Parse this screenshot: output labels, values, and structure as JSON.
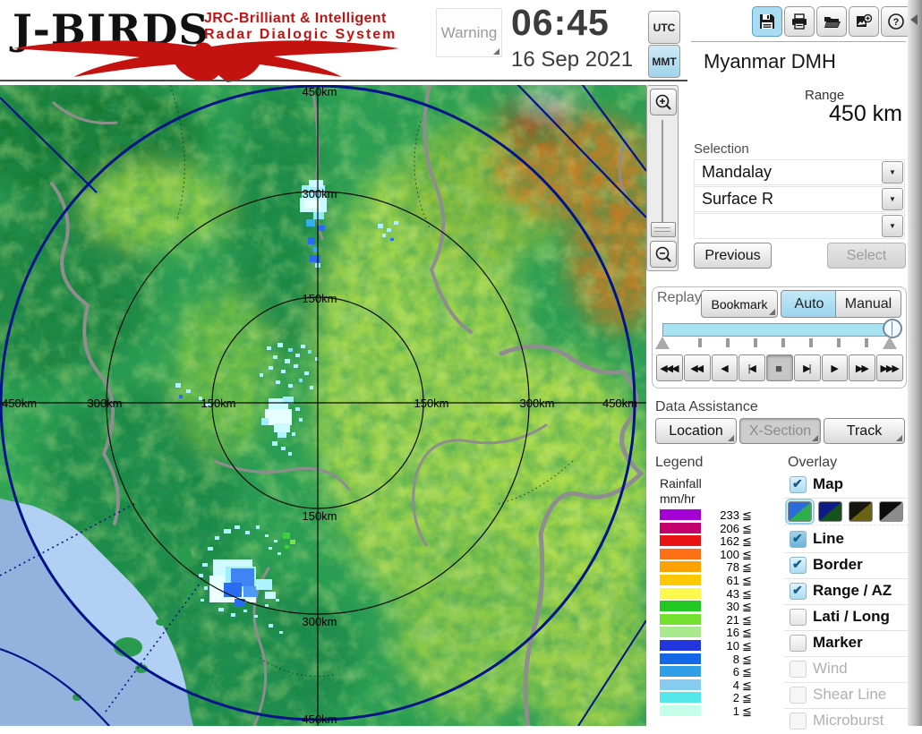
{
  "header": {
    "logo_title": "J-BIRDS",
    "logo_tagline1": "JRC-Brilliant & Intelligent",
    "logo_tagline2": "Radar  Dialogic  System",
    "warning_button": "Warning",
    "time": "06:45",
    "date": "16 Sep 2021",
    "tz_utc": "UTC",
    "tz_mmt": "MMT",
    "tz_active": "MMT",
    "toolbar_icons": [
      "save-icon",
      "print-icon",
      "open-folder-icon",
      "export-image-icon",
      "help-icon"
    ],
    "station_name": "Myanmar DMH"
  },
  "map": {
    "v_labels": [
      "450km",
      "300km",
      "150km",
      "150km",
      "300km",
      "450km"
    ],
    "h_labels": [
      "450km",
      "300km",
      "150km",
      "150km",
      "300km",
      "450km"
    ]
  },
  "panel": {
    "range_label": "Range",
    "range_value": "450 km",
    "selection_label": "Selection",
    "dropdown1": "Mandalay",
    "dropdown2": "Surface R",
    "dropdown3": "",
    "previous_button": "Previous",
    "select_button": "Select",
    "replay": {
      "label": "Replay",
      "bookmark": "Bookmark",
      "auto": "Auto",
      "manual": "Manual",
      "active_mode": "Auto",
      "progress_percent": 100,
      "transport": [
        "◀◀◀",
        "◀◀",
        "◀",
        "|◀",
        "■",
        "▶|",
        "▶",
        "▶▶",
        "▶▶▶"
      ]
    },
    "data_assistance_label": "Data Assistance",
    "da_location": "Location",
    "da_xsection": "X-Section",
    "da_track": "Track",
    "legend_title": "Legend",
    "overlay_title": "Overlay",
    "legend": {
      "unit1": "Rainfall",
      "unit2": "mm/hr",
      "suffix": "≦",
      "entries": [
        {
          "value": "233",
          "color": "#a400d6"
        },
        {
          "value": "206",
          "color": "#c4006e"
        },
        {
          "value": "162",
          "color": "#e81414"
        },
        {
          "value": "100",
          "color": "#ff7014"
        },
        {
          "value": "78",
          "color": "#ffa200"
        },
        {
          "value": "61",
          "color": "#ffc800"
        },
        {
          "value": "43",
          "color": "#fdf84e"
        },
        {
          "value": "30",
          "color": "#22c822"
        },
        {
          "value": "21",
          "color": "#74e030"
        },
        {
          "value": "16",
          "color": "#aaea8e"
        },
        {
          "value": "10",
          "color": "#2136dd"
        },
        {
          "value": "8",
          "color": "#1468e8"
        },
        {
          "value": "6",
          "color": "#2f9fe8"
        },
        {
          "value": "4",
          "color": "#86ccf0"
        },
        {
          "value": "2",
          "color": "#54e8ea"
        },
        {
          "value": "1",
          "color": "#c4ffea"
        }
      ]
    },
    "overlay_items": [
      {
        "label": "Map",
        "checked": true,
        "enabled": true
      },
      {
        "label": "Line",
        "checked": true,
        "enabled": true
      },
      {
        "label": "Border",
        "checked": true,
        "enabled": true
      },
      {
        "label": "Range / AZ",
        "checked": true,
        "enabled": true
      },
      {
        "label": "Lati / Long",
        "checked": false,
        "enabled": true
      },
      {
        "label": "Marker",
        "checked": false,
        "enabled": true
      },
      {
        "label": "Wind",
        "checked": false,
        "enabled": false
      },
      {
        "label": "Shear Line",
        "checked": false,
        "enabled": false
      },
      {
        "label": "Microburst",
        "checked": false,
        "enabled": false
      }
    ],
    "map_styles": [
      {
        "colors": [
          "#2a6cd8",
          "#2fae4d"
        ],
        "selected": true
      },
      {
        "colors": [
          "#101a86",
          "#14521e"
        ],
        "selected": false
      },
      {
        "colors": [
          "#17160e",
          "#6b6214"
        ],
        "selected": false
      },
      {
        "colors": [
          "#0c0c0c",
          "#8c8c8c"
        ],
        "selected": false
      }
    ]
  },
  "colors": {
    "accent_blue": "#9fd4ec",
    "brand_red": "#c41210",
    "progress_cyan": "#a9e2f0",
    "ring_navy": "#001489"
  }
}
